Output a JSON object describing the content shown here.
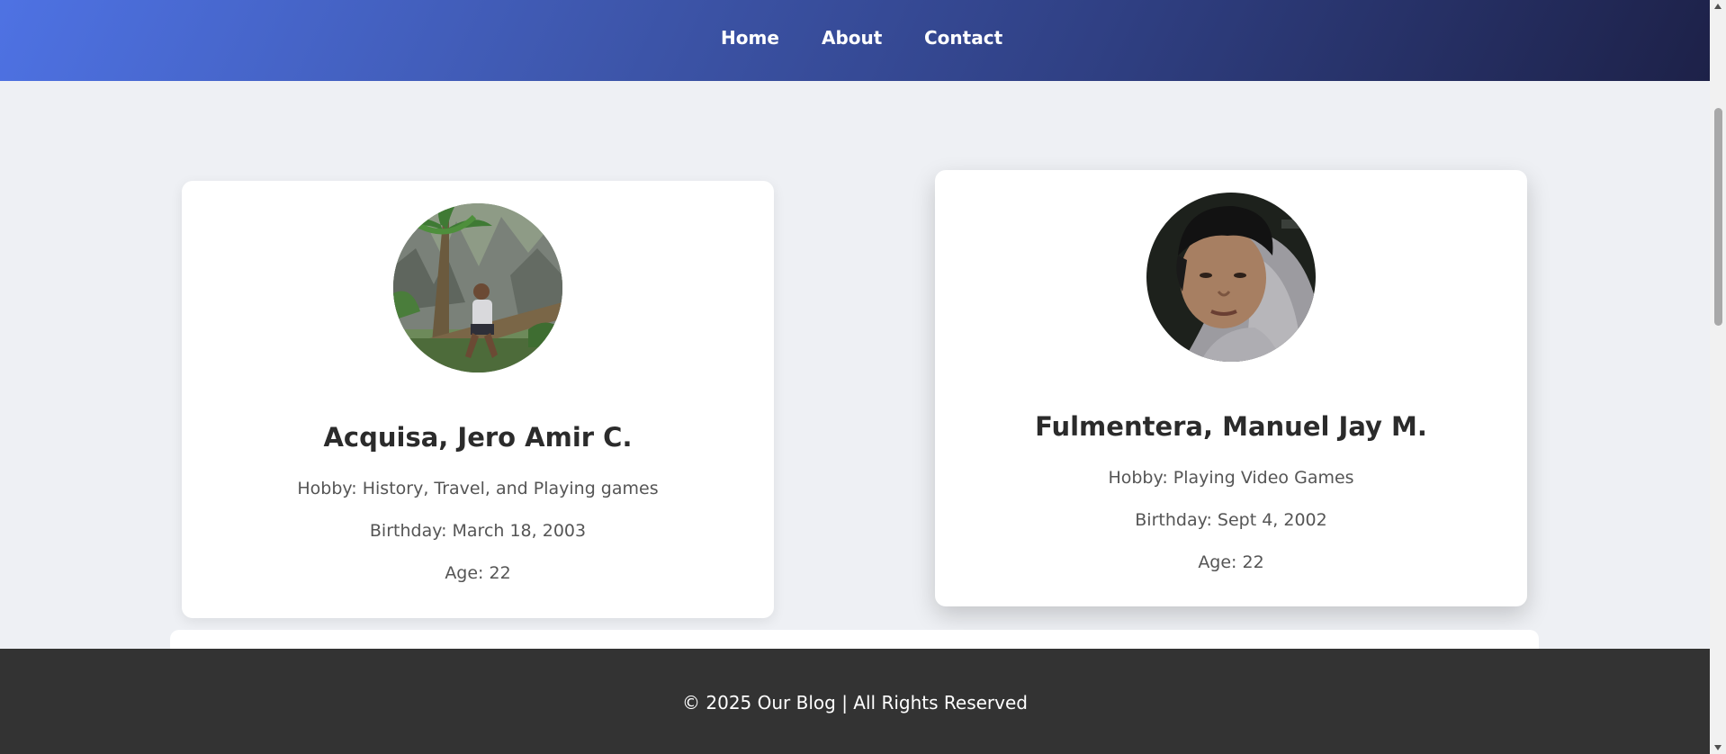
{
  "nav": {
    "items": [
      {
        "label": "Home"
      },
      {
        "label": "About"
      },
      {
        "label": "Contact"
      }
    ]
  },
  "profiles": [
    {
      "name": "Acquisa, Jero Amir C.",
      "hobby": "Hobby: History, Travel, and Playing games",
      "birthday": "Birthday: March 18, 2003",
      "age": "Age: 22",
      "photo_icon": "jungle-portrait-photo"
    },
    {
      "name": "Fulmentera, Manuel Jay M.",
      "hobby": "Hobby: Playing Video Games",
      "birthday": "Birthday: Sept 4, 2002",
      "age": "Age: 22",
      "photo_icon": "selfie-portrait-photo"
    }
  ],
  "footer": {
    "text": "© 2025 Our Blog | All Rights Reserved"
  },
  "colors": {
    "header_gradient_start": "#4e72e3",
    "header_gradient_end": "#1d2148",
    "page_background": "#eef0f4",
    "footer_background": "#333333"
  }
}
